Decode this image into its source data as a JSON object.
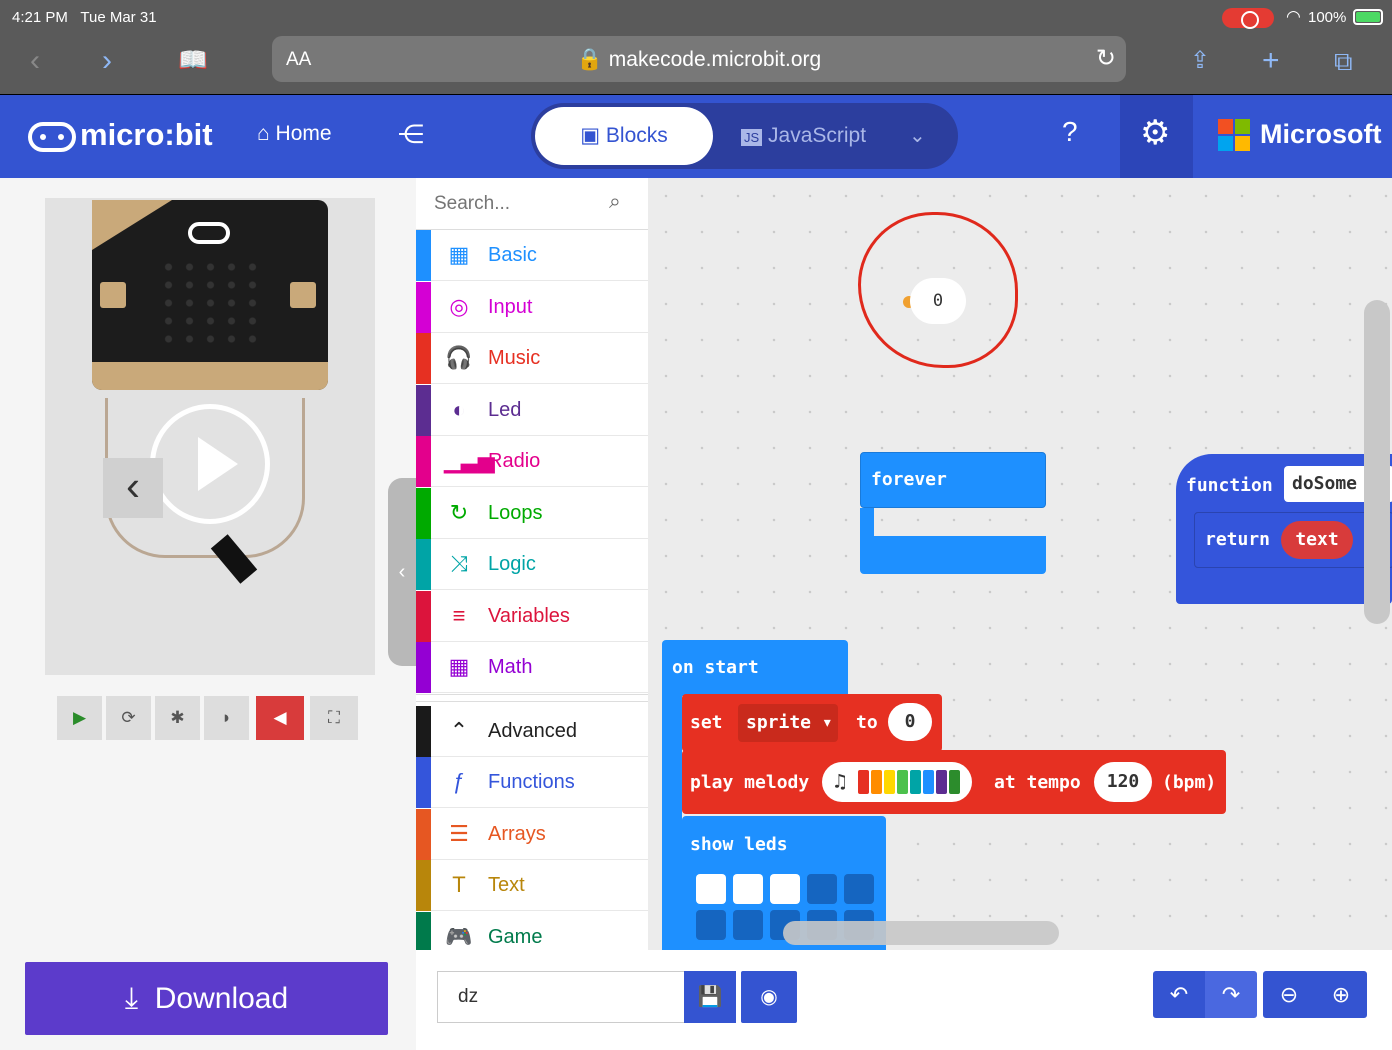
{
  "status_bar": {
    "time": "4:21 PM",
    "date": "Tue Mar 31",
    "battery": "100%"
  },
  "safari": {
    "text_size": "AA",
    "url": "makecode.microbit.org"
  },
  "header": {
    "logo_text": "micro:bit",
    "home_label": "Home",
    "tabs": {
      "blocks": "Blocks",
      "javascript": "JavaScript"
    },
    "brand": "Microsoft"
  },
  "colors": {
    "header": "#3454d1",
    "download": "#5c3bcb",
    "red": "#d83b3b"
  },
  "toolbox": {
    "search_placeholder": "Search...",
    "categories": [
      {
        "label": "Basic",
        "color": "#1e90ff",
        "icon": "grid-icon"
      },
      {
        "label": "Input",
        "color": "#d400d4",
        "icon": "target-icon"
      },
      {
        "label": "Music",
        "color": "#e63022",
        "icon": "headphones-icon"
      },
      {
        "label": "Led",
        "color": "#5c2d91",
        "icon": "toggle-icon"
      },
      {
        "label": "Radio",
        "color": "#e3008c",
        "icon": "signal-icon"
      },
      {
        "label": "Loops",
        "color": "#00aa00",
        "icon": "loop-icon"
      },
      {
        "label": "Logic",
        "color": "#00a4a6",
        "icon": "shuffle-icon"
      },
      {
        "label": "Variables",
        "color": "#dc143c",
        "icon": "lines-icon"
      },
      {
        "label": "Math",
        "color": "#9400d3",
        "icon": "calculator-icon"
      },
      {
        "label": "Advanced",
        "color": "#1a1a1a",
        "icon": "chevron-up-icon"
      },
      {
        "label": "Functions",
        "color": "#3455db",
        "icon": "function-icon"
      },
      {
        "label": "Arrays",
        "color": "#e65722",
        "icon": "list-icon"
      },
      {
        "label": "Text",
        "color": "#b8860b",
        "icon": "text-icon"
      },
      {
        "label": "Game",
        "color": "#007a4b",
        "icon": "gamepad-icon"
      }
    ]
  },
  "simulator": {
    "download_label": "Download"
  },
  "workspace": {
    "floating_value": "0",
    "forever_label": "forever",
    "function_label": "function",
    "function_name": "doSome",
    "return_label": "return",
    "text_label": "text",
    "on_start_label": "on start",
    "set_label": "set",
    "sprite_var": "sprite",
    "to_label": "to",
    "set_value": "0",
    "play_melody_label": "play melody",
    "at_tempo_label": "at tempo",
    "tempo_value": "120",
    "bpm_label": "(bpm)",
    "show_leds_label": "show leds"
  },
  "bottom": {
    "project_name": "dz"
  }
}
